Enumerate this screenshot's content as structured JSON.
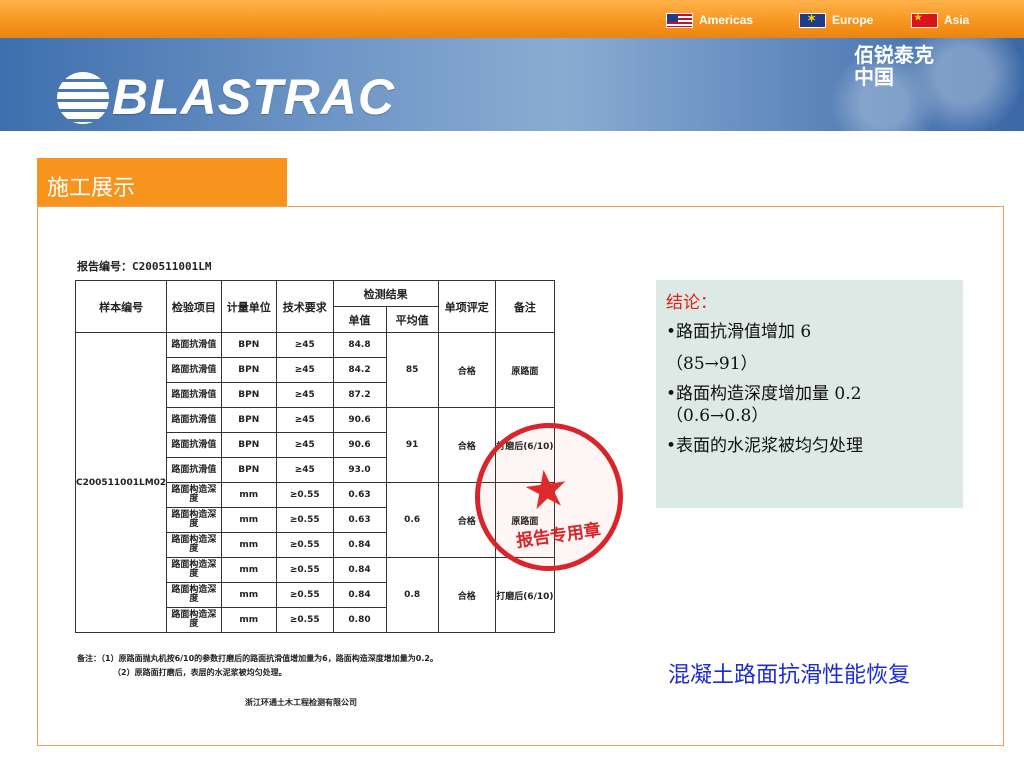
{
  "header": {
    "regions": [
      {
        "label": "Americas",
        "flag": "us-flag-icon"
      },
      {
        "label": "Europe",
        "flag": "eu-flag-icon"
      },
      {
        "label": "Asia",
        "flag": "cn-flag-icon"
      }
    ],
    "logo_text": "BLASTRAC",
    "brand_cn_line1": "佰锐泰克",
    "brand_cn_line2": "中国"
  },
  "section": {
    "tab_label": "施工展示"
  },
  "report": {
    "report_no": "报告编号：C200511001LM",
    "headers": {
      "sample_no": "样本编号",
      "item": "检验项目",
      "unit": "计量单位",
      "requirement": "技术要求",
      "result": "检测结果",
      "single": "单值",
      "average": "平均值",
      "judgement": "单项评定",
      "remark": "备注"
    },
    "sample_id": "C200511001LM02",
    "rows": [
      {
        "item": "路面抗滑值",
        "unit": "BPN",
        "req": "≥45",
        "value": "84.8"
      },
      {
        "item": "路面抗滑值",
        "unit": "BPN",
        "req": "≥45",
        "value": "84.2"
      },
      {
        "item": "路面抗滑值",
        "unit": "BPN",
        "req": "≥45",
        "value": "87.2"
      },
      {
        "item": "路面抗滑值",
        "unit": "BPN",
        "req": "≥45",
        "value": "90.6"
      },
      {
        "item": "路面抗滑值",
        "unit": "BPN",
        "req": "≥45",
        "value": "90.6"
      },
      {
        "item": "路面抗滑值",
        "unit": "BPN",
        "req": "≥45",
        "value": "93.0"
      },
      {
        "item": "路面构造深度",
        "unit": "mm",
        "req": "≥0.55",
        "value": "0.63"
      },
      {
        "item": "路面构造深度",
        "unit": "mm",
        "req": "≥0.55",
        "value": "0.63"
      },
      {
        "item": "路面构造深度",
        "unit": "mm",
        "req": "≥0.55",
        "value": "0.84"
      },
      {
        "item": "路面构造深度",
        "unit": "mm",
        "req": "≥0.55",
        "value": "0.84"
      },
      {
        "item": "路面构造深度",
        "unit": "mm",
        "req": "≥0.55",
        "value": "0.84"
      },
      {
        "item": "路面构造深度",
        "unit": "mm",
        "req": "≥0.55",
        "value": "0.80"
      }
    ],
    "groups": [
      {
        "average": "85",
        "judgement": "合格",
        "remark": "原路面"
      },
      {
        "average": "91",
        "judgement": "合格",
        "remark": "打磨后(6/10)"
      },
      {
        "average": "0.6",
        "judgement": "合格",
        "remark": "原路面"
      },
      {
        "average": "0.8",
        "judgement": "合格",
        "remark": "打磨后(6/10)"
      }
    ],
    "note1": "备注：（1）原路面抛丸机按6/10的参数打磨后的路面抗滑值增加量为6，路面构造深度增加量为0.2。",
    "note2": "（2）原路面打磨后，表层的水泥浆被均匀处理。",
    "organization": "浙江环通土木工程检测有限公司",
    "seal_text": "报告专用章"
  },
  "conclusion": {
    "title": "结论：",
    "point1": "•路面抗滑值增加 6",
    "point1_detail": "（85→91）",
    "point2": "•路面构造深度增加量 0.2",
    "point2_detail": "（0.6→0.8）",
    "point3": "•表面的水泥浆被均匀处理"
  },
  "caption": "混凝土路面抗滑性能恢复",
  "colors": {
    "orange": "#f7941d",
    "blue_banner": "#5c85bb",
    "caption_blue": "#1c2bd6",
    "red": "#e0201c",
    "box_green": "#dde9e4"
  }
}
